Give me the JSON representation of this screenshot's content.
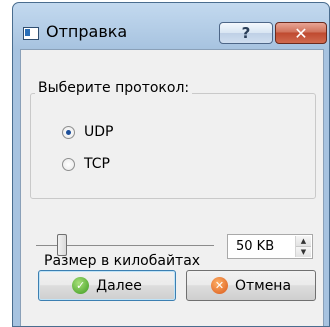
{
  "window": {
    "title": "Отправка",
    "help_glyph": "?",
    "close_glyph": "✕"
  },
  "protocol_group": {
    "title": "Выберите протокол:",
    "options": [
      {
        "label": "UDP",
        "checked": true
      },
      {
        "label": "TCP",
        "checked": false
      }
    ]
  },
  "size": {
    "label": "Размер в килобайтах",
    "value_text": "50 KB",
    "spin_up": "▲",
    "spin_down": "▼"
  },
  "buttons": {
    "next_label": "Далее",
    "next_icon": "✓",
    "cancel_label": "Отмена",
    "cancel_icon": "✕"
  },
  "colors": {
    "title_bar": "#b1cbe5",
    "close_button": "#c7553b",
    "radio_dot": "#1c4f9a"
  },
  "icons": {
    "window": "app-window-icon",
    "next": "check-icon",
    "cancel": "cancel-icon"
  }
}
